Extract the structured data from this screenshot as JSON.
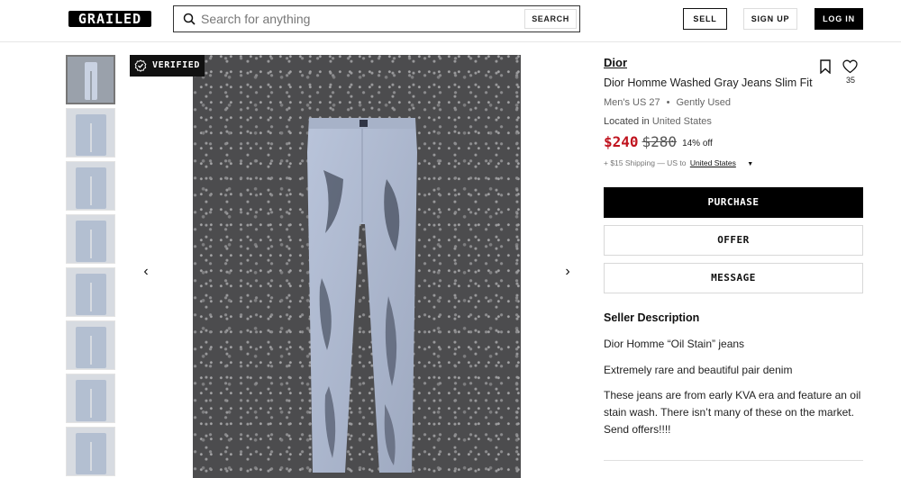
{
  "header": {
    "logo_text": "GRAILED",
    "search_placeholder": "Search for anything",
    "search_button": "SEARCH",
    "sell_label": "SELL",
    "signup_label": "SIGN UP",
    "login_label": "LOG IN"
  },
  "gallery": {
    "verified_label": "VERIFIED",
    "thumbnail_count": 8,
    "active_index": 0
  },
  "listing": {
    "brand": "Dior",
    "title": "Dior Homme Washed Gray Jeans Slim Fit",
    "like_count": "35",
    "size": "Men's US 27",
    "condition": "Gently Used",
    "location_label": "Located in",
    "location_value": "United States",
    "price": "$240",
    "original_price": "$280",
    "discount": "14% off",
    "shipping_prefix": "+ $15 Shipping — US to",
    "shipping_country": "United States"
  },
  "actions": {
    "purchase": "PURCHASE",
    "offer": "OFFER",
    "message": "MESSAGE"
  },
  "description": {
    "heading": "Seller Description",
    "lines": [
      "Dior Homme “Oil Stain” jeans",
      "Extremely rare and beautiful pair denim",
      "These jeans are from early KVA era and feature an oil stain wash. There isn’t many of these on the market. Send offers!!!!"
    ]
  },
  "icons": {
    "search": "search-icon",
    "bookmark": "bookmark-icon",
    "heart": "heart-icon",
    "verified": "verified-badge-icon",
    "prev": "chevron-left-icon",
    "next": "chevron-right-icon",
    "caret": "caret-down-icon"
  },
  "colors": {
    "price_red": "#c0141f",
    "primary_black": "#000000",
    "border_gray": "#d8d8d8"
  }
}
